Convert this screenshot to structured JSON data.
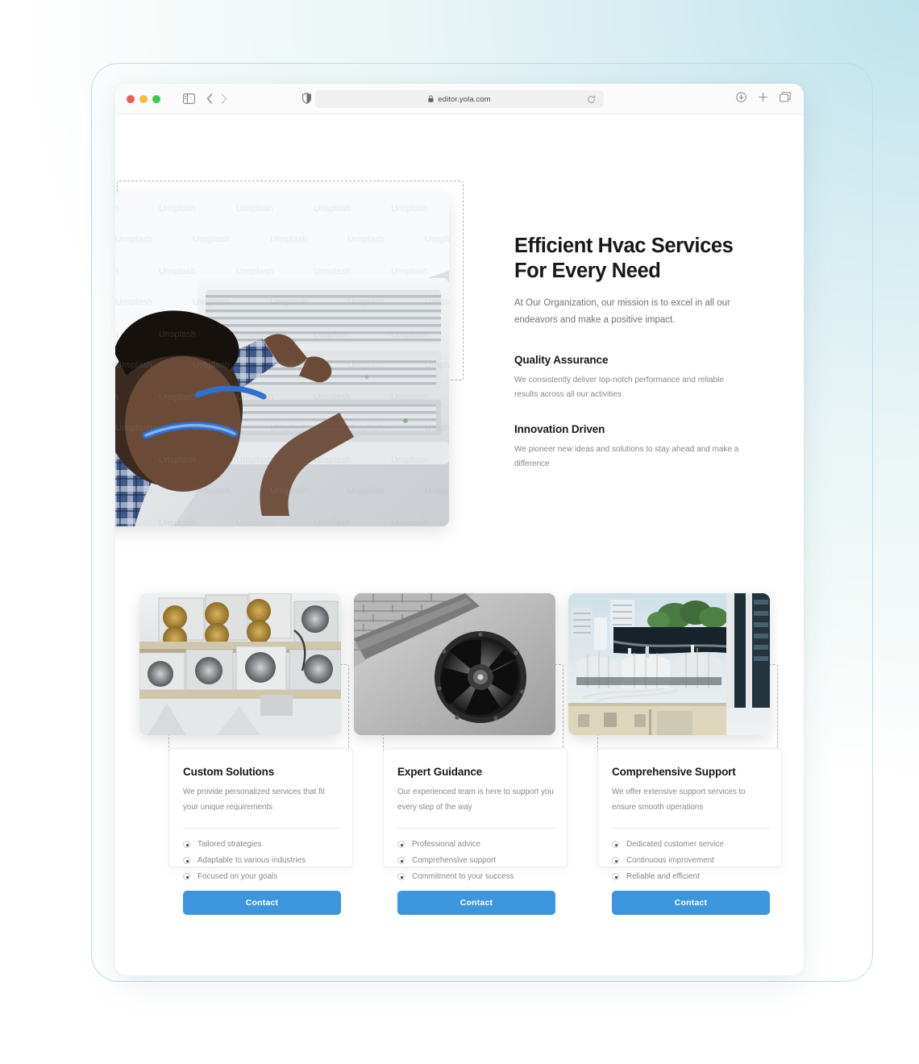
{
  "browser": {
    "url": "editor.yola.com",
    "lock_icon": "lock-icon",
    "traffic_lights": [
      "close-red",
      "minimize-yellow",
      "zoom-green"
    ],
    "sidebar_icon": "sidebar-toggle-icon",
    "back_icon": "chevron-left-icon",
    "forward_icon": "chevron-right-icon",
    "shield_icon": "privacy-shield-icon",
    "reload_icon": "reload-icon",
    "download_icon": "download-icon",
    "new_tab_icon": "plus-icon",
    "tabs_icon": "tab-overview-icon"
  },
  "hero": {
    "title": "Efficient Hvac Services For Every Need",
    "subtitle": "At Our Organization, our mission is to excel in all our endeavors and make a positive impact.",
    "image_name": "hvac-technician-servicing-indoor-unit",
    "features": [
      {
        "title": "Quality Assurance",
        "body": "We consistently deliver top-notch performance and reliable results across all our activities"
      },
      {
        "title": "Innovation Driven",
        "body": "We pioneer new ideas and solutions to stay ahead and make a difference"
      }
    ]
  },
  "cards": [
    {
      "image_name": "outdoor-condenser-units-rack",
      "title": "Custom Solutions",
      "desc": "We provide personalized services that fit your unique requirements",
      "items": [
        "Tailored strategies",
        "Adaptable to various industries",
        "Focused on your goals"
      ],
      "button": "Contact"
    },
    {
      "image_name": "wall-mounted-exhaust-fan-grayscale",
      "title": "Expert Guidance",
      "desc": "Our experienced team is here to support you every step of the way",
      "items": [
        "Professional advice",
        "Comprehensive support",
        "Commitment to your success"
      ],
      "button": "Contact"
    },
    {
      "image_name": "rooftop-cooling-towers-city",
      "title": "Comprehensive Support",
      "desc": "We offer extensive support services to ensure smooth operations",
      "items": [
        "Dedicated customer service",
        "Continuous improvement",
        "Reliable and efficient"
      ],
      "button": "Contact"
    }
  ],
  "colors": {
    "accent_blue": "#3d96dd",
    "heading": "#17181a",
    "body_text": "#85888c",
    "page_bg_topright": "#cde7ef",
    "page_bg_bottomleft": "#eef8f5",
    "selection_dash": "#b4b4b4"
  }
}
